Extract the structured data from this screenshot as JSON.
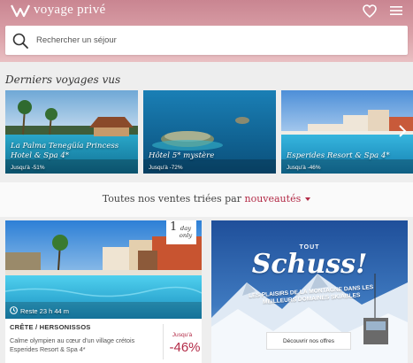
{
  "header": {
    "brand": "voyage privé",
    "search_placeholder": "Rechercher un séjour"
  },
  "recent": {
    "title": "Derniers voyages vus",
    "items": [
      {
        "title": "La Palma Tenegüía Princess Hotel & Spa 4*",
        "discount": "Jusqu'à -51%"
      },
      {
        "title": "Hôtel 5* mystère",
        "discount": "Jusqu'à -72%"
      },
      {
        "title": "Esperides Resort & Spa 4*",
        "discount": "Jusqu'à -46%"
      }
    ]
  },
  "sort": {
    "prefix": "Toutes nos ventes triées par",
    "value": "nouveautés"
  },
  "deal": {
    "badge_num": "1",
    "badge_day": "day",
    "badge_only": "only",
    "timer": "Reste 23 h 44 m",
    "location": "CRÊTE / HERSONISSOS",
    "description": "Calme olympien au cœur d'un village crétois Esperides Resort & Spa 4*",
    "up_to": "Jusqu'à",
    "discount": "-46%"
  },
  "promo": {
    "tout": "TOUT",
    "headline": "Schuss!",
    "subline": "LES PLAISIRS DE LA MONTAGNE DANS LES MEILLEURS DOMAINES SKIABLES",
    "button": "Découvrir nos offres"
  },
  "colors": {
    "accent": "#b32b47",
    "header_top": "#c98591",
    "header_bottom": "#e9c0c3"
  }
}
